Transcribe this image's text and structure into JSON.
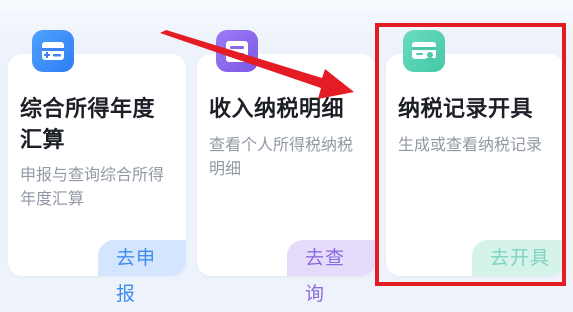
{
  "cards": [
    {
      "title": "综合所得年度汇算",
      "description": "申报与查询综合所得年度汇算",
      "action_label": "去申报",
      "icon": "tax-form-plus-icon",
      "color": "#3e8cf0"
    },
    {
      "title": "收入纳税明细",
      "description": "查看个人所得税纳税明细",
      "action_label": "去查询",
      "icon": "tax-detail-icon",
      "color": "#8c6bde"
    },
    {
      "title": "纳税记录开具",
      "description": "生成或查看纳税记录",
      "action_label": "去开具",
      "icon": "tax-record-stamp-icon",
      "color": "#4ec9a8"
    }
  ],
  "annotations": {
    "highlight_color": "#e41c24",
    "arrow_color": "#e41c24"
  }
}
